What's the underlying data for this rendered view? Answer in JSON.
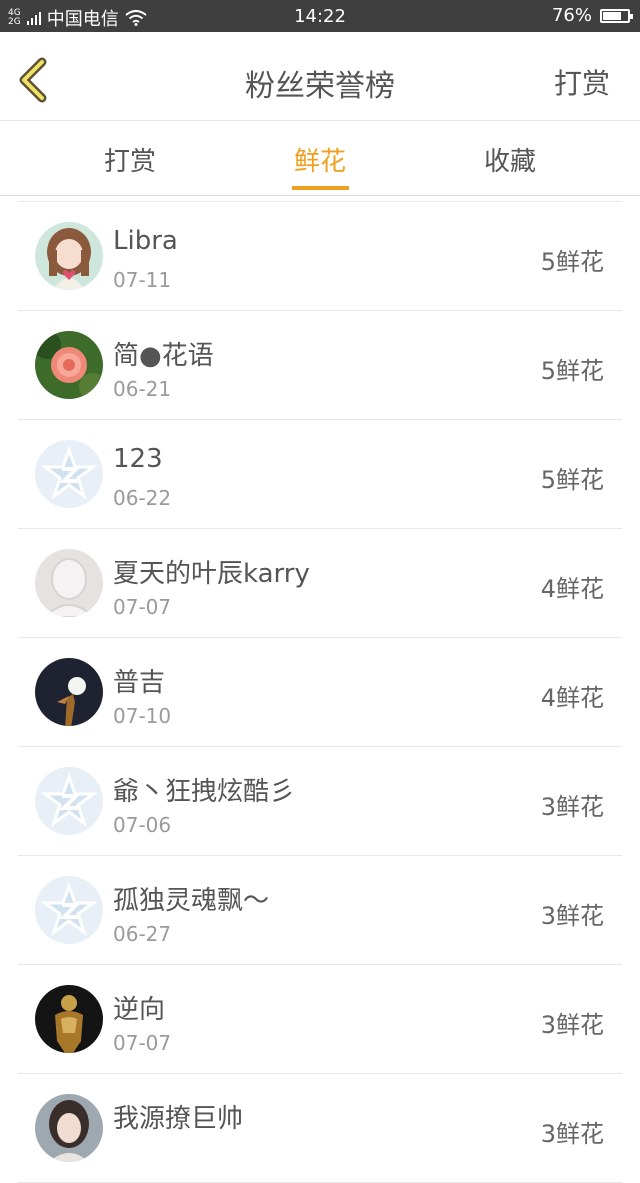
{
  "status_bar": {
    "network": "4G 2G",
    "carrier": "中国电信",
    "time": "14:22",
    "battery": "76%",
    "battery_level": 0.76
  },
  "header": {
    "title": "粉丝荣誉榜",
    "action_label": "打赏",
    "accent_color": "#f0a020"
  },
  "tabs": [
    {
      "label": "打赏"
    },
    {
      "label": "鲜花",
      "active": true
    },
    {
      "label": "收藏"
    }
  ],
  "fans": [
    {
      "name": "Libra",
      "date": "07-11",
      "count": "5鲜花",
      "avatar": "girl-avatar-icon"
    },
    {
      "name": "简●花语",
      "date": "06-21",
      "count": "5鲜花",
      "avatar": "flower-avatar-icon"
    },
    {
      "name": "123",
      "date": "06-22",
      "count": "5鲜花",
      "avatar": "default-qq-avatar-icon"
    },
    {
      "name": "夏天的叶辰karry",
      "date": "07-07",
      "count": "4鲜花",
      "avatar": "silhouette-avatar-icon"
    },
    {
      "name": "普吉",
      "date": "07-10",
      "count": "4鲜花",
      "avatar": "night-moon-avatar-icon"
    },
    {
      "name": "爺丶狂拽炫酷彡",
      "date": "07-06",
      "count": "3鲜花",
      "avatar": "default-qq-avatar-icon"
    },
    {
      "name": "孤独灵魂飘～",
      "date": "06-27",
      "count": "3鲜花",
      "avatar": "default-qq-avatar-icon"
    },
    {
      "name": "逆向",
      "date": "07-07",
      "count": "3鲜花",
      "avatar": "golden-figure-avatar-icon"
    },
    {
      "name": "我源撩巨帅",
      "date": "",
      "count": "3鲜花",
      "avatar": "portrait-avatar-icon"
    }
  ]
}
